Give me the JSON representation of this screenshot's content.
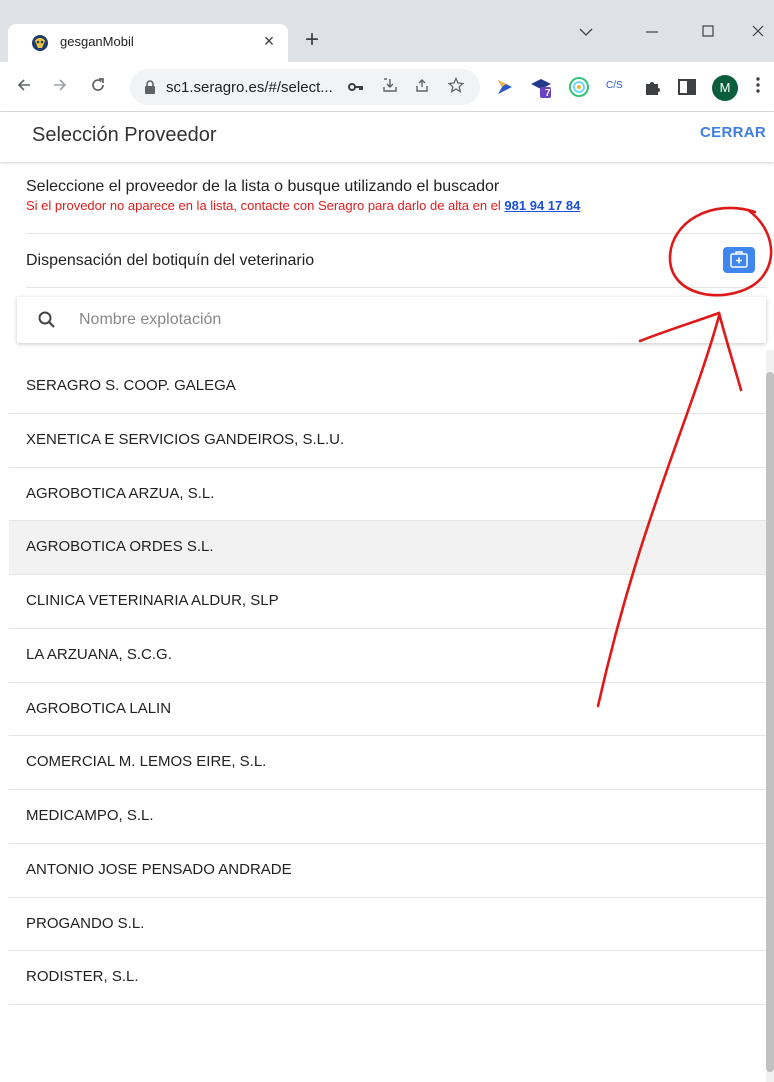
{
  "browser": {
    "tab_title": "gesganMobil",
    "tab_close": "×",
    "new_tab": "+",
    "url": "sc1.seragro.es/#/select...",
    "avatar_initial": "M",
    "ext_badge": "7",
    "ext_cs": "C/S"
  },
  "header": {
    "title": "Selección Proveedor",
    "close_label": "CERRAR"
  },
  "info": {
    "main_text": "Seleccione el proveedor de la lista o busque utilizando el buscador",
    "warning_text": "Si el provedor no aparece en la lista, contacte con Seragro para darlo de alta en el ",
    "phone": "981 94 17 84"
  },
  "dispensation": {
    "label": "Dispensación del botiquín del veterinario",
    "button_icon": "medical-kit-plus-icon"
  },
  "search": {
    "placeholder": "Nombre explotación",
    "icon": "search-icon"
  },
  "providers": [
    "SERAGRO S. COOP. GALEGA",
    "XENETICA E SERVICIOS GANDEIROS, S.L.U.",
    "AGROBOTICA ARZUA, S.L.",
    "AGROBOTICA ORDES S.L.",
    "CLINICA VETERINARIA ALDUR, SLP",
    "LA ARZUANA, S.C.G.",
    "AGROBOTICA LALIN",
    "COMERCIAL M. LEMOS EIRE, S.L.",
    "MEDICAMPO, S.L.",
    "ANTONIO JOSE PENSADO ANDRADE",
    "PROGANDO S.L.",
    "RODISTER, S.L."
  ],
  "colors": {
    "accent": "#3f86f1",
    "close_link": "#3f7fe0",
    "warning": "#e31b1b",
    "annotation": "#e01818"
  }
}
